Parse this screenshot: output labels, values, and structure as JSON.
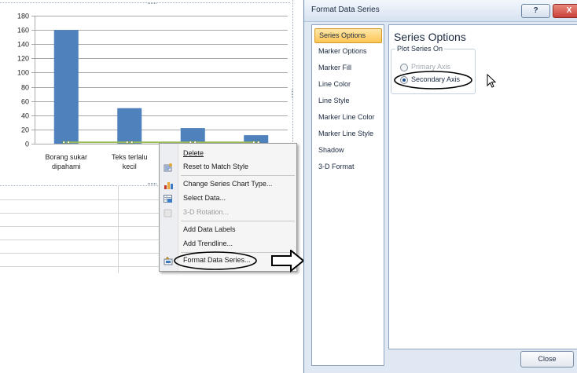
{
  "chart_data": {
    "type": "bar",
    "categories": [
      "Borang sukar dipahami",
      "Teks terlalu kecil",
      "",
      ""
    ],
    "category_lines": [
      [
        "Borang sukar",
        "dipahami"
      ],
      [
        "Teks terlalu",
        "kecil"
      ],
      [
        "",
        ""
      ],
      [
        "",
        ""
      ]
    ],
    "values": [
      160,
      50,
      22,
      12
    ],
    "secondary_values": [
      2,
      2,
      2,
      2
    ],
    "ylim": [
      0,
      180
    ],
    "yticks": [
      0,
      20,
      40,
      60,
      80,
      100,
      120,
      140,
      160,
      180
    ],
    "grid": true,
    "bar_color": "#4f81bd",
    "line_color": "#9bbb59"
  },
  "context_menu": {
    "items": [
      {
        "label": "Delete",
        "icon": "delete",
        "disabled": false
      },
      {
        "label": "Reset to Match Style",
        "icon": "reset-style-icon",
        "disabled": false
      },
      {
        "label": "Change Series Chart Type...",
        "icon": "chart-type-icon",
        "disabled": false
      },
      {
        "label": "Select Data...",
        "icon": "select-data-icon",
        "disabled": false
      },
      {
        "label": "3-D Rotation...",
        "icon": "rotation-icon",
        "disabled": true
      },
      {
        "label": "Add Data Labels",
        "icon": "",
        "disabled": false
      },
      {
        "label": "Add Trendline...",
        "icon": "",
        "disabled": false
      },
      {
        "label": "Format Data Series...",
        "icon": "format-icon",
        "disabled": false
      }
    ]
  },
  "dialog": {
    "title": "Format Data Series",
    "help_label": "?",
    "close_x_label": "X",
    "nav": [
      {
        "label": "Series Options",
        "selected": true
      },
      {
        "label": "Marker Options",
        "selected": false
      },
      {
        "label": "Marker Fill",
        "selected": false
      },
      {
        "label": "Line Color",
        "selected": false
      },
      {
        "label": "Line Style",
        "selected": false
      },
      {
        "label": "Marker Line Color",
        "selected": false
      },
      {
        "label": "Marker Line Style",
        "selected": false
      },
      {
        "label": "Shadow",
        "selected": false
      },
      {
        "label": "3-D Format",
        "selected": false
      }
    ],
    "section_title": "Series Options",
    "group_label": "Plot Series On",
    "options": [
      {
        "label": "Primary Axis",
        "checked": false
      },
      {
        "label": "Secondary Axis",
        "checked": true
      }
    ],
    "close_label": "Close"
  },
  "colors": {
    "accent": "#ffc555",
    "dialog_bg": "#dfe8f3",
    "close_x_bg": "#c9413a"
  }
}
